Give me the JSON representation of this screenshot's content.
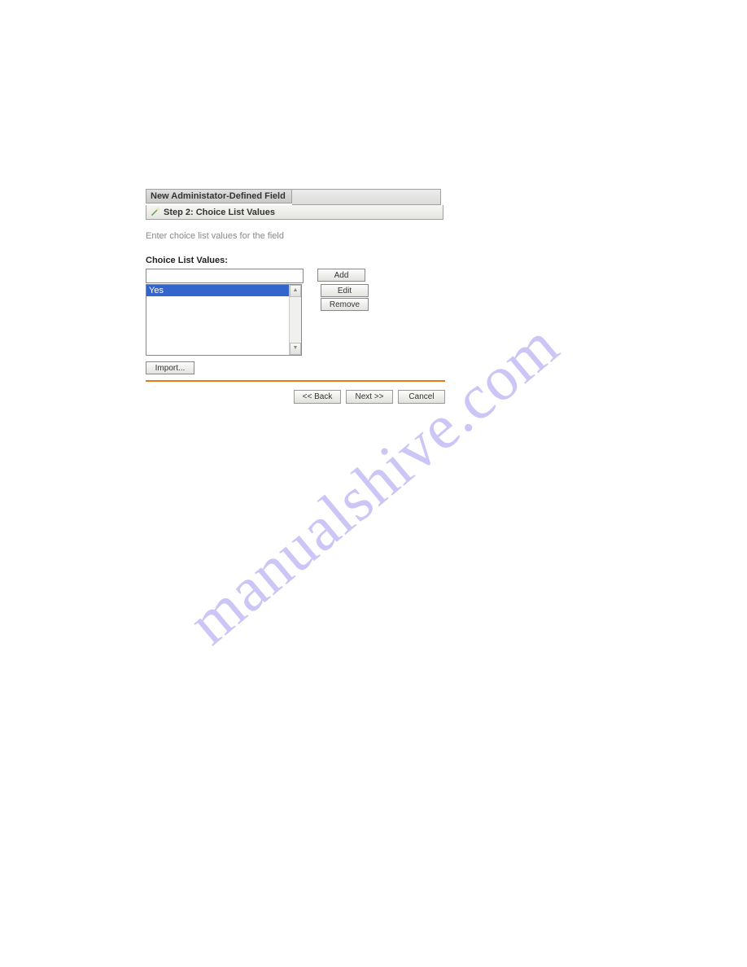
{
  "wizard": {
    "title": "New Administator-Defined Field",
    "step_label": "Step 2: Choice List Values",
    "instruction": "Enter choice list values for the field",
    "section_label": "Choice List Values:",
    "buttons": {
      "add": "Add",
      "edit": "Edit",
      "remove": "Remove",
      "import": "Import...",
      "back": "<<  Back",
      "next": "Next  >>",
      "cancel": "Cancel"
    },
    "input_value": "",
    "list_items": [
      "Yes"
    ]
  },
  "watermark": "manualshive.com"
}
